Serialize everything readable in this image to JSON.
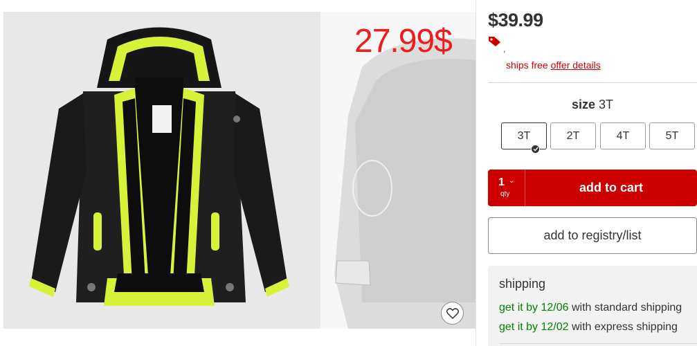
{
  "gallery": {
    "overlay_price": "27.99$",
    "favorite_icon": "heart-icon"
  },
  "product": {
    "price": "$39.99",
    "price_tag_icon": "price-tag-icon",
    "promo_mark": ",",
    "ships_free": "ships free",
    "offer_details": "offer details",
    "colors": {
      "accent": "#cc0000",
      "green": "#008300",
      "overlay": "#ee1c1c"
    }
  },
  "size": {
    "label": "size",
    "selected": "3T",
    "options": [
      "3T",
      "2T",
      "4T",
      "5T"
    ]
  },
  "cart": {
    "qty": "1",
    "qty_label": "qty",
    "chevron_icon": "chevron-down-icon",
    "button_label": "add to cart"
  },
  "registry": {
    "button_label": "add to registry/list"
  },
  "shipping": {
    "title": "shipping",
    "options": [
      {
        "date": "get it by 12/06",
        "method": "with standard shipping"
      },
      {
        "date": "get it by 12/02",
        "method": "with express shipping"
      }
    ]
  }
}
